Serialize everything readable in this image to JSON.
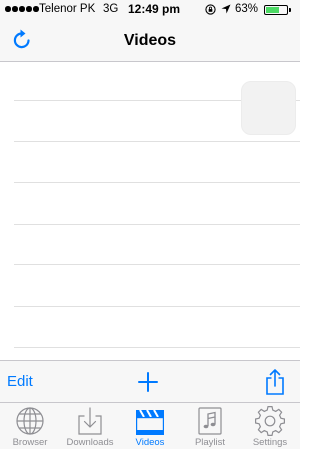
{
  "status_bar": {
    "carrier": "Telenor PK",
    "network": "3G",
    "time": "12:49 pm",
    "battery": "63%",
    "battery_level": 0.63
  },
  "nav": {
    "title": "Videos",
    "left_icon": "refresh-icon"
  },
  "toolbar": {
    "edit_label": "Edit",
    "add_icon": "plus-icon",
    "share_icon": "share-icon"
  },
  "tabs": [
    {
      "label": "Browser",
      "icon": "globe-icon",
      "active": false
    },
    {
      "label": "Downloads",
      "icon": "download-icon",
      "active": false
    },
    {
      "label": "Videos",
      "icon": "clapperboard-icon",
      "active": true
    },
    {
      "label": "Playlist",
      "icon": "music-note-icon",
      "active": false
    },
    {
      "label": "Settings",
      "icon": "gear-icon",
      "active": false
    }
  ],
  "colors": {
    "accent": "#007aff",
    "inactive": "#8e8e93",
    "bar_bg": "#f7f7f7"
  }
}
